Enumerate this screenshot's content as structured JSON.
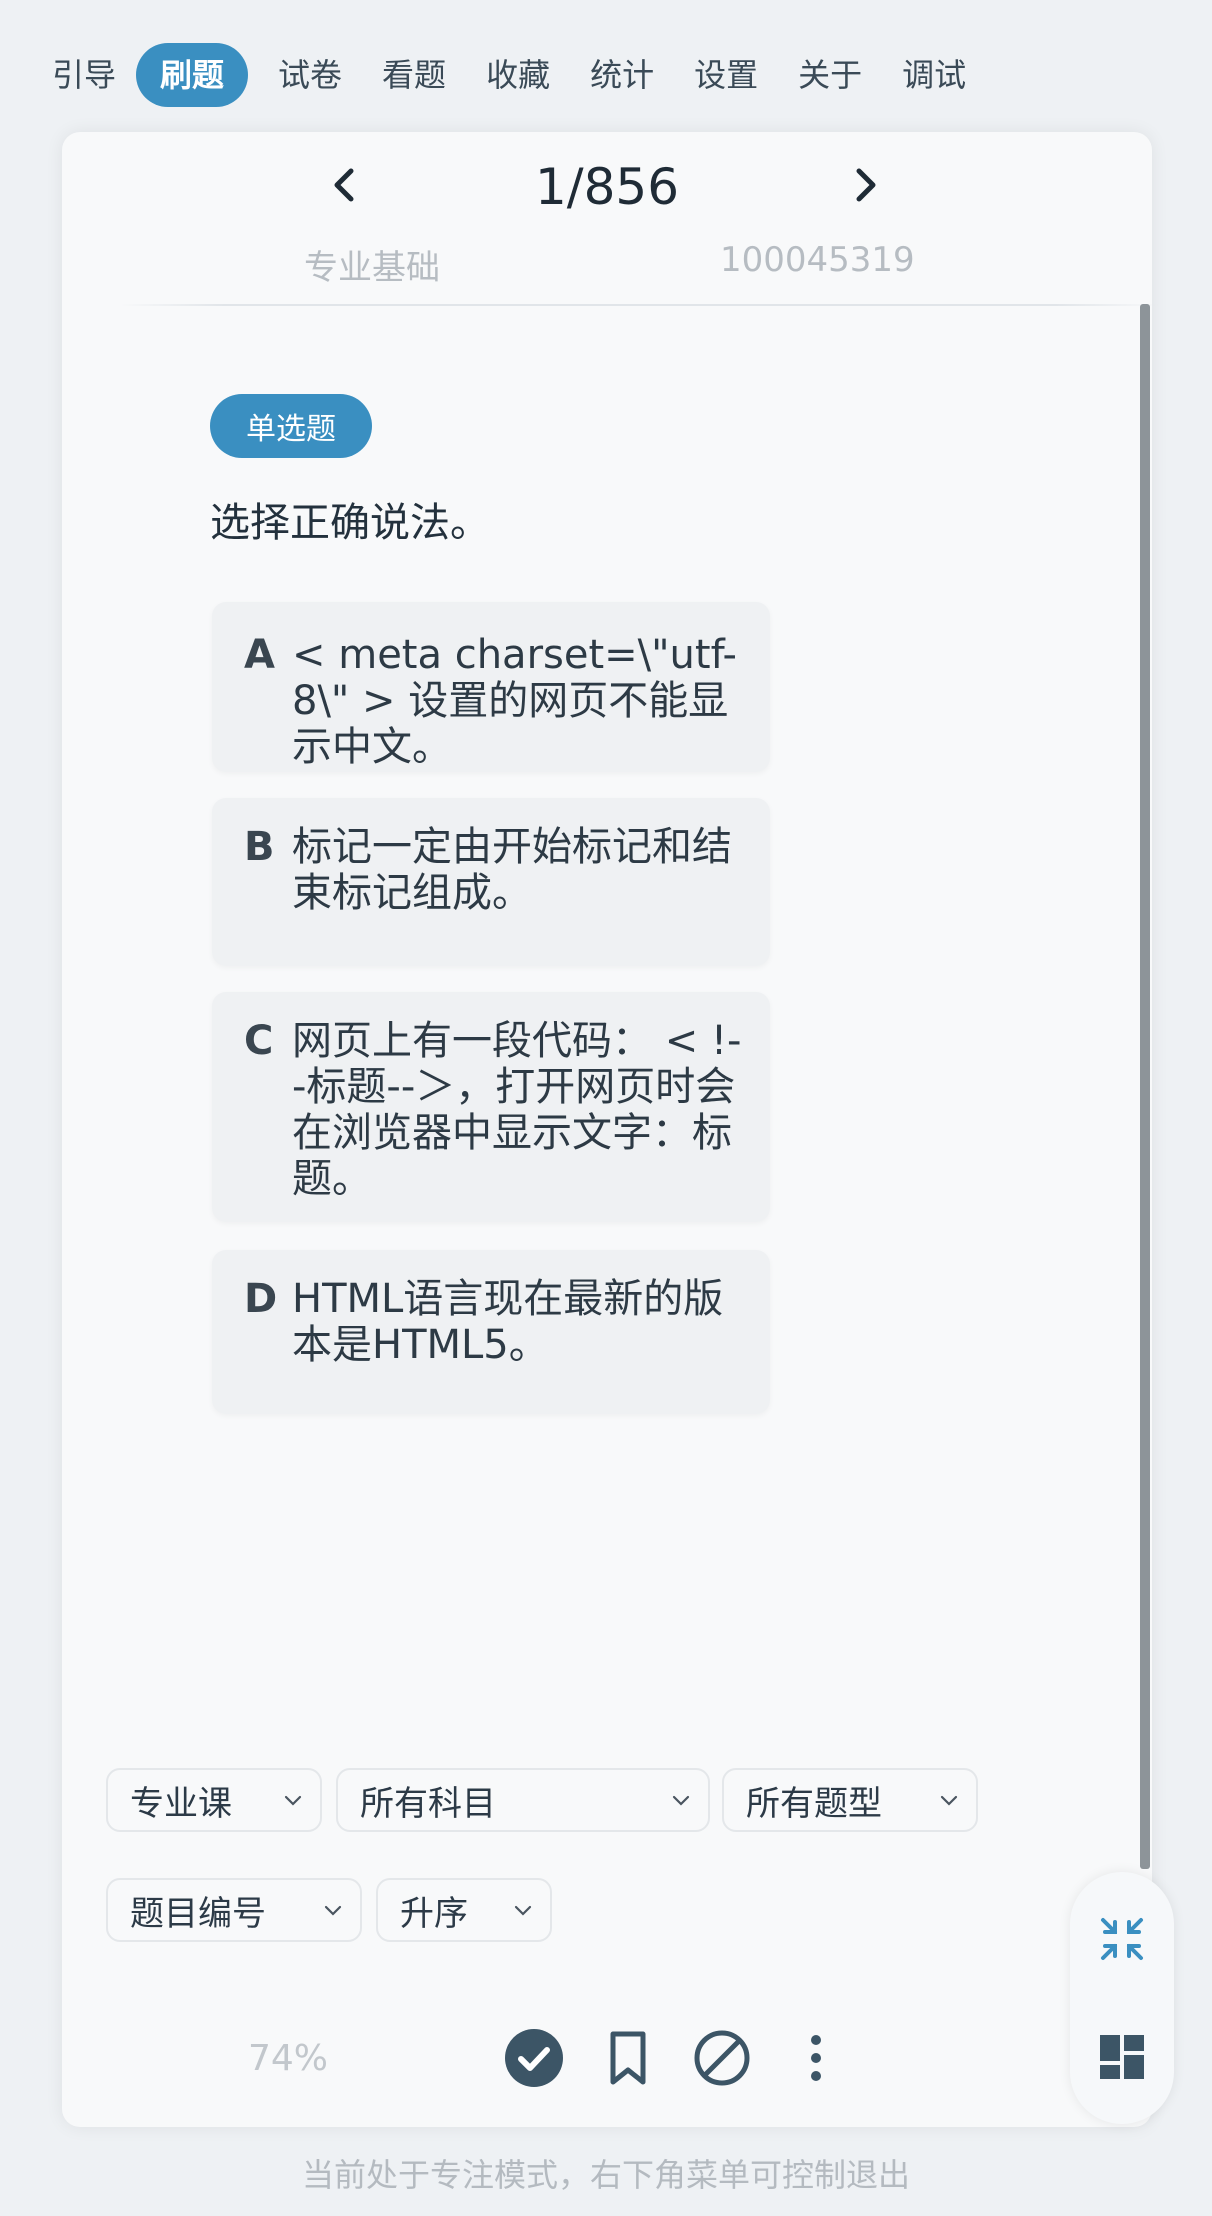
{
  "nav": {
    "items": [
      "引导",
      "刷题",
      "试卷",
      "看题",
      "收藏",
      "统计",
      "设置",
      "关于",
      "调试"
    ],
    "active": "刷题"
  },
  "pager": {
    "counter": "1/856"
  },
  "meta": {
    "subject": "专业基础",
    "id": "100045319"
  },
  "question": {
    "type": "单选题",
    "text": "选择正确说法。",
    "options": [
      {
        "letter": "A",
        "text": "< meta charset=\\\"utf-8\\\" > 设置的网页不能显示中文。"
      },
      {
        "letter": "B",
        "text": "标记一定由开始标记和结束标记组成。"
      },
      {
        "letter": "C",
        "text": "网页上有一段代码： < !--标题--＞，打开网页时会在浏览器中显示文字：标题。"
      },
      {
        "letter": "D",
        "text": "HTML语言现在最新的版本是HTML5。"
      }
    ]
  },
  "filters": {
    "course": "专业课",
    "subject": "所有科目",
    "qtype": "所有题型",
    "sort_by": "题目编号",
    "order": "升序"
  },
  "actions": {
    "progress": "74%"
  },
  "footer": {
    "text": "当前处于专注模式，右下角菜单可控制退出"
  },
  "colors": {
    "accent": "#3a8fc1",
    "icon_dark": "#3c5566"
  },
  "icons": [
    "chevron-left-icon",
    "chevron-right-icon",
    "check-circle-icon",
    "bookmark-icon",
    "block-icon",
    "more-vertical-icon",
    "collapse-icon",
    "dashboard-icon"
  ]
}
